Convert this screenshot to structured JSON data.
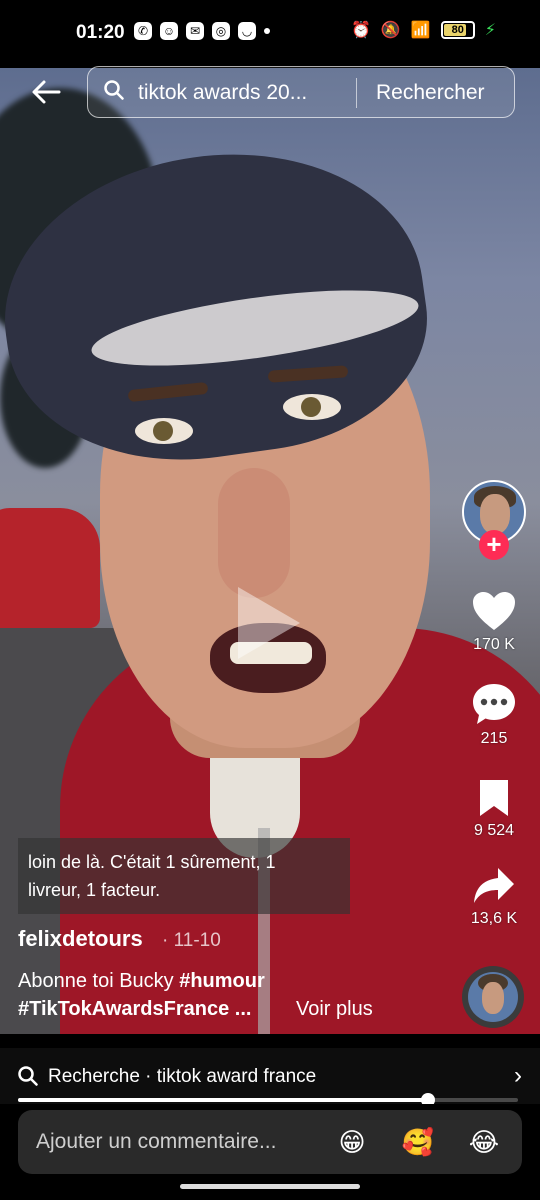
{
  "status_bar": {
    "time": "01:20",
    "battery": "80",
    "battery_fraction": 0.8
  },
  "search": {
    "query": "tiktok awards 20...",
    "button": "Rechercher"
  },
  "actions": {
    "likes": "170 K",
    "comments": "215",
    "saves": "9 524",
    "shares": "13,6 K"
  },
  "caption": {
    "line1": "loin de là. C'était 1 sûrement, 1",
    "line2": "livreur, 1 facteur."
  },
  "post": {
    "author": "felixdetours",
    "date": "· 11-10",
    "desc_text": "Abonne toi Bucky ",
    "hashtag1": "#humour",
    "hashtag2": "#TikTokAwardsFrance ...",
    "more": "Voir plus"
  },
  "related_search": {
    "text": "Recherche · tiktok award france"
  },
  "playback": {
    "progress": 0.82
  },
  "comment_bar": {
    "placeholder": "Ajouter un commentaire...",
    "emojis": [
      "😁",
      "🥰",
      "😂"
    ]
  },
  "colors": {
    "accent": "#fe2c55",
    "battery": "#e9d36a"
  }
}
